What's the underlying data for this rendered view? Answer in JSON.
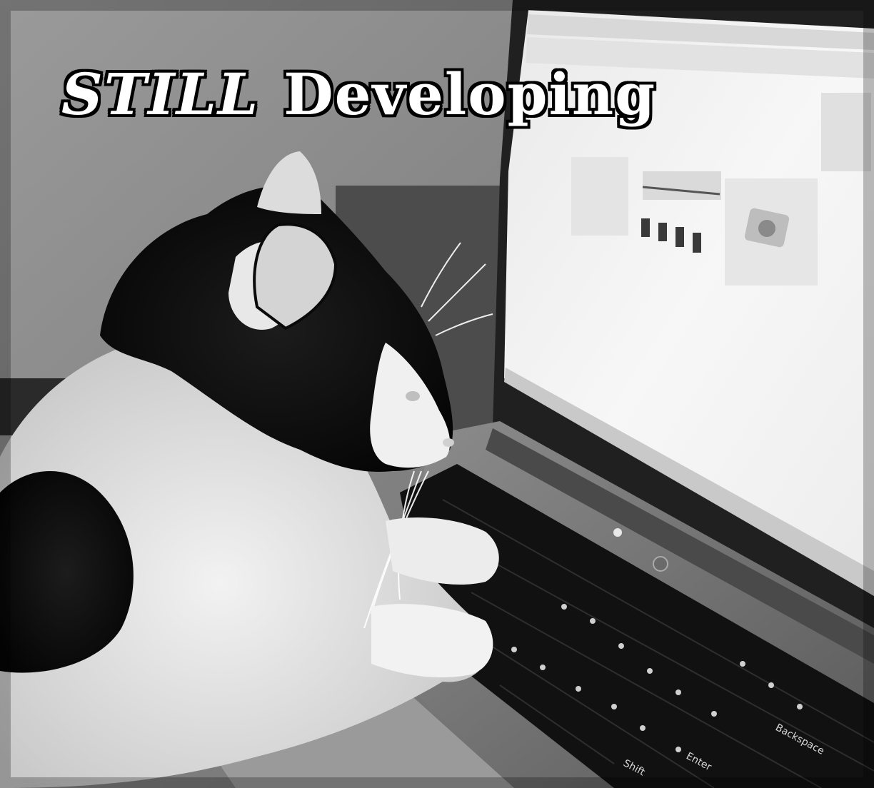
{
  "caption": {
    "word1": "STILL",
    "word2": "Developing"
  },
  "keyboard": {
    "backspace": "Backspace",
    "enter": "Enter",
    "shift": "Shift"
  },
  "colors": {
    "caption_fill": "#ffffff",
    "caption_outline": "#000000",
    "screen": "#f4f4f4",
    "laptop_body": "#7a7a7a",
    "keyboard": "#121212",
    "wall": "#8c8c8c"
  }
}
